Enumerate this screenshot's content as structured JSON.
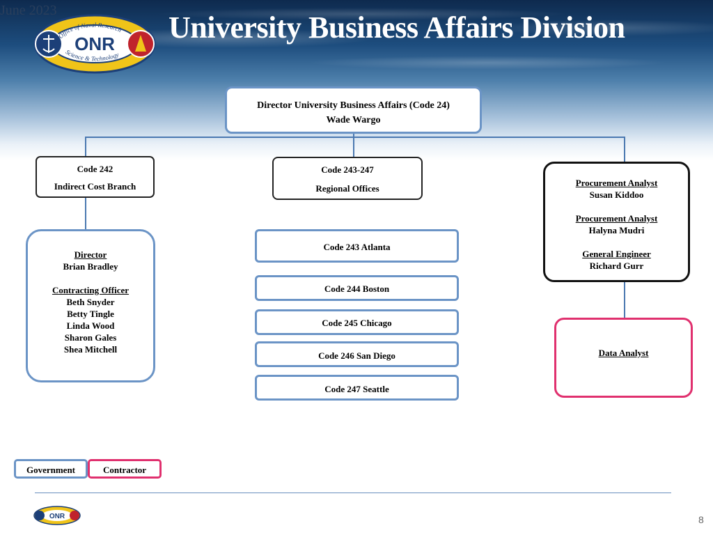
{
  "header": {
    "date": "June 2023",
    "title": "University Business Affairs Division",
    "logo_text_top": "Office of Naval Research",
    "logo_text_bottom": "Science & Technology",
    "logo_mark": "ONR"
  },
  "director_box": {
    "line1": "Director University Business Affairs (Code 24)",
    "line2": "Wade Wargo"
  },
  "code242": {
    "code": "Code 242",
    "name": "Indirect Cost Branch"
  },
  "code243_247": {
    "code": "Code 243-247",
    "name": "Regional Offices"
  },
  "branch_staff": {
    "director_title": "Director",
    "director_name": "Brian Bradley",
    "co_title": "Contracting Officer",
    "co_names": [
      "Beth Snyder",
      "Betty Tingle",
      "Linda Wood",
      "Sharon Gales",
      "Shea Mitchell"
    ]
  },
  "regional_offices": [
    "Code 243 Atlanta",
    "Code 244 Boston",
    "Code 245 Chicago",
    "Code 246 San Diego",
    "Code 247 Seattle"
  ],
  "staff_box": {
    "roles": [
      {
        "title": "Procurement Analyst",
        "name": "Susan Kiddoo"
      },
      {
        "title": "Procurement  Analyst",
        "name": "Halyna Mudri"
      },
      {
        "title": "General Engineer",
        "name": "Richard Gurr"
      }
    ]
  },
  "contractor_box": {
    "title": "Data Analyst"
  },
  "legend": {
    "government": "Government",
    "contractor": "Contractor"
  },
  "footer": {
    "page_number": "8"
  },
  "colors": {
    "government_border": "#6b94c6",
    "contractor_border": "#e0306e",
    "connector": "#4a78b0"
  }
}
